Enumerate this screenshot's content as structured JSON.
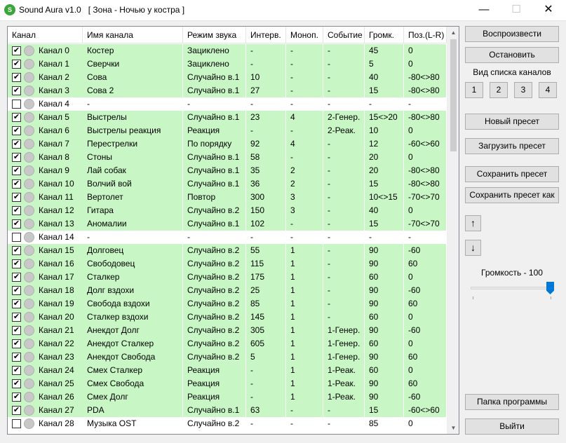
{
  "window": {
    "app_icon_text": "S",
    "title": "Sound Aura v1.0   [ Зона - Ночью у костра ]",
    "minimize": "—",
    "maximize": "☐",
    "close": "✕"
  },
  "table": {
    "columns": [
      "Канал",
      "Имя канала",
      "Режим звука",
      "Интерв.",
      "Моноп.",
      "Событие",
      "Громк.",
      "Поз.(L-R)"
    ],
    "rows": [
      {
        "enabled": true,
        "channel": "Канал 0",
        "name": "Костер",
        "mode": "Зациклено",
        "interval": "-",
        "mono": "-",
        "event": "-",
        "volume": "45",
        "pos": "0"
      },
      {
        "enabled": true,
        "channel": "Канал 1",
        "name": "Сверчки",
        "mode": "Зациклено",
        "interval": "-",
        "mono": "-",
        "event": "-",
        "volume": "5",
        "pos": "0"
      },
      {
        "enabled": true,
        "channel": "Канал 2",
        "name": "Сова",
        "mode": "Случайно в.1",
        "interval": "10",
        "mono": "-",
        "event": "-",
        "volume": "40",
        "pos": "-80<>80"
      },
      {
        "enabled": true,
        "channel": "Канал 3",
        "name": "Сова 2",
        "mode": "Случайно в.1",
        "interval": "27",
        "mono": "-",
        "event": "-",
        "volume": "15",
        "pos": "-80<>80"
      },
      {
        "enabled": false,
        "channel": "Канал 4",
        "name": "-",
        "mode": "-",
        "interval": "-",
        "mono": "-",
        "event": "-",
        "volume": "-",
        "pos": "-"
      },
      {
        "enabled": true,
        "channel": "Канал 5",
        "name": "Выстрелы",
        "mode": "Случайно в.1",
        "interval": "23",
        "mono": "4",
        "event": "2-Генер.",
        "volume": "15<>20",
        "pos": "-80<>80"
      },
      {
        "enabled": true,
        "channel": "Канал 6",
        "name": "Выстрелы реакция",
        "mode": "Реакция",
        "interval": "-",
        "mono": "-",
        "event": "2-Реак.",
        "volume": "10",
        "pos": "0"
      },
      {
        "enabled": true,
        "channel": "Канал 7",
        "name": "Перестрелки",
        "mode": "По порядку",
        "interval": "92",
        "mono": "4",
        "event": "-",
        "volume": "12",
        "pos": "-60<>60"
      },
      {
        "enabled": true,
        "channel": "Канал 8",
        "name": "Стоны",
        "mode": "Случайно в.1",
        "interval": "58",
        "mono": "-",
        "event": "-",
        "volume": "20",
        "pos": "0"
      },
      {
        "enabled": true,
        "channel": "Канал 9",
        "name": "Лай собак",
        "mode": "Случайно в.1",
        "interval": "35",
        "mono": "2",
        "event": "-",
        "volume": "20",
        "pos": "-80<>80"
      },
      {
        "enabled": true,
        "channel": "Канал 10",
        "name": "Волчий вой",
        "mode": "Случайно в.1",
        "interval": "36",
        "mono": "2",
        "event": "-",
        "volume": "15",
        "pos": "-80<>80"
      },
      {
        "enabled": true,
        "channel": "Канал 11",
        "name": "Вертолет",
        "mode": "Повтор",
        "interval": "300",
        "mono": "3",
        "event": "-",
        "volume": "10<>15",
        "pos": "-70<>70"
      },
      {
        "enabled": true,
        "channel": "Канал 12",
        "name": "Гитара",
        "mode": "Случайно в.2",
        "interval": "150",
        "mono": "3",
        "event": "-",
        "volume": "40",
        "pos": "0"
      },
      {
        "enabled": true,
        "channel": "Канал 13",
        "name": "Аномалии",
        "mode": "Случайно в.1",
        "interval": "102",
        "mono": "-",
        "event": "-",
        "volume": "15",
        "pos": "-70<>70"
      },
      {
        "enabled": false,
        "channel": "Канал 14",
        "name": "-",
        "mode": "-",
        "interval": "-",
        "mono": "-",
        "event": "-",
        "volume": "-",
        "pos": "-"
      },
      {
        "enabled": true,
        "channel": "Канал 15",
        "name": "Долговец",
        "mode": "Случайно в.2",
        "interval": "55",
        "mono": "1",
        "event": "-",
        "volume": "90",
        "pos": "-60"
      },
      {
        "enabled": true,
        "channel": "Канал 16",
        "name": "Свободовец",
        "mode": "Случайно в.2",
        "interval": "115",
        "mono": "1",
        "event": "-",
        "volume": "90",
        "pos": "60"
      },
      {
        "enabled": true,
        "channel": "Канал 17",
        "name": "Сталкер",
        "mode": "Случайно в.2",
        "interval": "175",
        "mono": "1",
        "event": "-",
        "volume": "60",
        "pos": "0"
      },
      {
        "enabled": true,
        "channel": "Канал 18",
        "name": "Долг вздохи",
        "mode": "Случайно в.2",
        "interval": "25",
        "mono": "1",
        "event": "-",
        "volume": "90",
        "pos": "-60"
      },
      {
        "enabled": true,
        "channel": "Канал 19",
        "name": "Свобода вздохи",
        "mode": "Случайно в.2",
        "interval": "85",
        "mono": "1",
        "event": "-",
        "volume": "90",
        "pos": "60"
      },
      {
        "enabled": true,
        "channel": "Канал 20",
        "name": "Сталкер вздохи",
        "mode": "Случайно в.2",
        "interval": "145",
        "mono": "1",
        "event": "-",
        "volume": "60",
        "pos": "0"
      },
      {
        "enabled": true,
        "channel": "Канал 21",
        "name": "Анекдот Долг",
        "mode": "Случайно в.2",
        "interval": "305",
        "mono": "1",
        "event": "1-Генер.",
        "volume": "90",
        "pos": "-60"
      },
      {
        "enabled": true,
        "channel": "Канал 22",
        "name": "Анекдот Сталкер",
        "mode": "Случайно в.2",
        "interval": "605",
        "mono": "1",
        "event": "1-Генер.",
        "volume": "60",
        "pos": "0"
      },
      {
        "enabled": true,
        "channel": "Канал 23",
        "name": "Анекдот Свобода",
        "mode": "Случайно в.2",
        "interval": "5",
        "mono": "1",
        "event": "1-Генер.",
        "volume": "90",
        "pos": "60"
      },
      {
        "enabled": true,
        "channel": "Канал 24",
        "name": "Смех Сталкер",
        "mode": "Реакция",
        "interval": "-",
        "mono": "1",
        "event": "1-Реак.",
        "volume": "60",
        "pos": "0"
      },
      {
        "enabled": true,
        "channel": "Канал 25",
        "name": "Смех Свобода",
        "mode": "Реакция",
        "interval": "-",
        "mono": "1",
        "event": "1-Реак.",
        "volume": "90",
        "pos": "60"
      },
      {
        "enabled": true,
        "channel": "Канал 26",
        "name": "Смех Долг",
        "mode": "Реакция",
        "interval": "-",
        "mono": "1",
        "event": "1-Реак.",
        "volume": "90",
        "pos": "-60"
      },
      {
        "enabled": true,
        "channel": "Канал 27",
        "name": "PDA",
        "mode": "Случайно в.1",
        "interval": "63",
        "mono": "-",
        "event": "-",
        "volume": "15",
        "pos": "-60<>60"
      },
      {
        "enabled": false,
        "channel": "Канал 28",
        "name": "Музыка OST",
        "mode": "Случайно в.2",
        "interval": "-",
        "mono": "-",
        "event": "-",
        "volume": "85",
        "pos": "0"
      }
    ],
    "row_colors": {
      "enabled": "#c8f7c5",
      "disabled": "#ffffff"
    }
  },
  "controls": {
    "play": "Воспроизвести",
    "stop": "Остановить",
    "view_label": "Вид списка каналов",
    "view_buttons": [
      "1",
      "2",
      "3",
      "4"
    ],
    "new_preset": "Новый пресет",
    "load_preset": "Загрузить пресет",
    "save_preset": "Сохранить пресет",
    "save_preset_as": "Сохранить пресет как",
    "move_up": "↑",
    "move_down": "↓",
    "volume_label": "Громкость - 100",
    "volume_level": 100,
    "program_folder": "Папка программы",
    "exit": "Выйти"
  },
  "colors": {
    "accent": "#0078d7",
    "app_icon": "#3aa53a"
  }
}
